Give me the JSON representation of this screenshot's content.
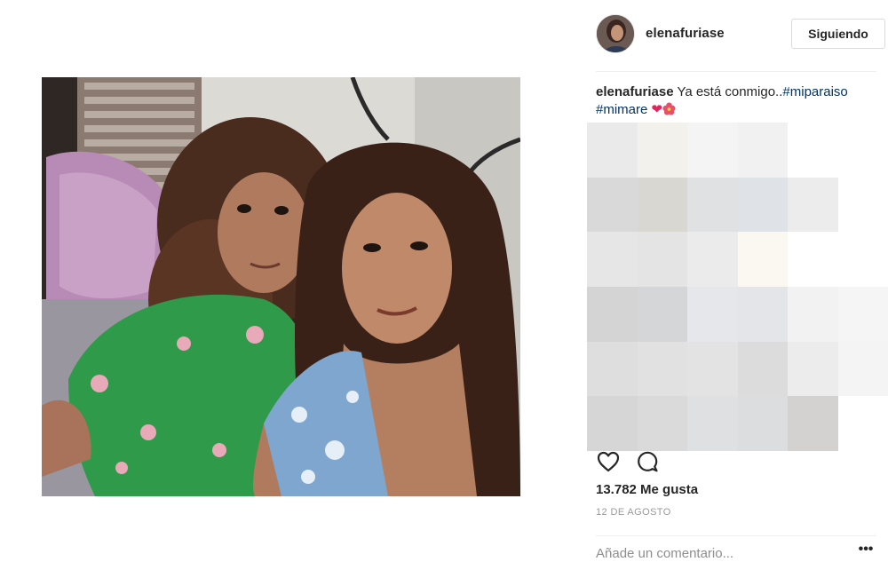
{
  "post": {
    "username": "elenafuriase",
    "follow_button_label": "Siguiendo",
    "caption": {
      "username": "elenafuriase",
      "text": " Ya está conmigo..",
      "hashtags": [
        "#miparaiso",
        "#mimare"
      ],
      "emojis": [
        "heart-emoji",
        "hibiscus-emoji"
      ]
    },
    "likes": "13.782 Me gusta",
    "date": "12 DE AGOSTO",
    "comment_placeholder": "Añade un comentario...",
    "more_label": "•••"
  },
  "icons": {
    "like": "heart-outline-icon",
    "comment": "speech-bubble-icon",
    "options": "more-options-icon"
  },
  "colors": {
    "hashtag": "#003569",
    "text": "#262626",
    "muted": "#999999",
    "border": "#dbdbdb",
    "heart_emoji": "#e0245e"
  }
}
